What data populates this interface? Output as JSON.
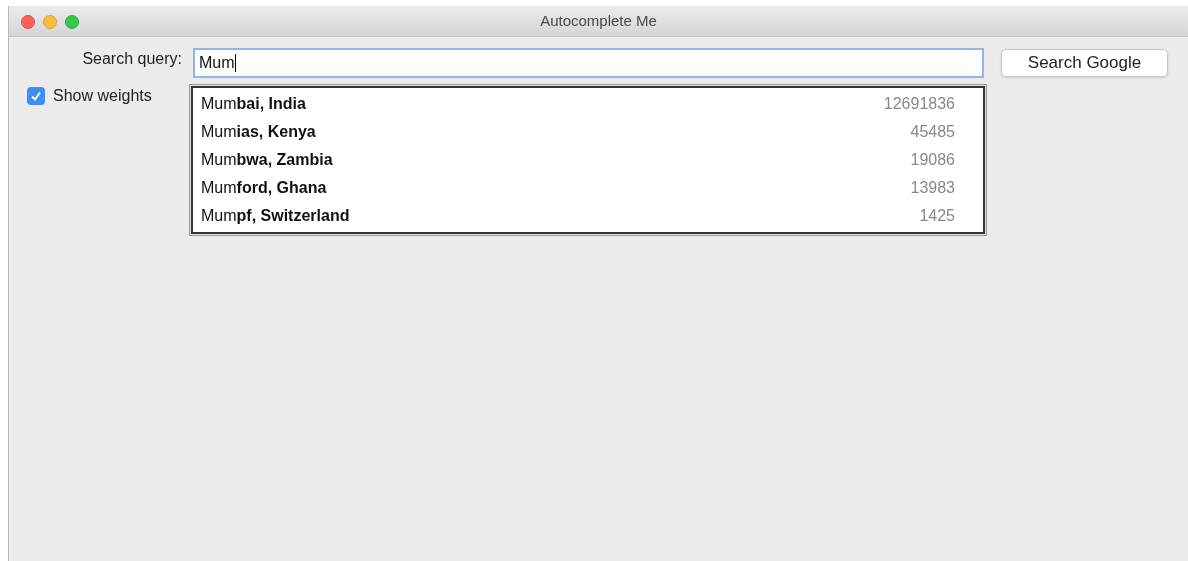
{
  "window": {
    "title": "Autocomplete Me"
  },
  "search": {
    "label": "Search query:",
    "value": "Mum"
  },
  "show_weights": {
    "label": "Show weights",
    "checked": true
  },
  "button": {
    "label": "Search Google"
  },
  "suggestions": [
    {
      "text": "Mum**bai, India**",
      "weight": "12691836",
      "selected": false
    },
    {
      "text": "Mum**ias, Kenya**",
      "weight": "45485",
      "selected": false
    },
    {
      "text": "Mum**bwa, Zambia**",
      "weight": "19086",
      "selected": false
    },
    {
      "text": "Mum**ford, Ghana**",
      "weight": "13983",
      "selected": false
    },
    {
      "text": "Mum**pf, Switzerland**",
      "weight": "1425",
      "selected": false
    }
  ]
}
